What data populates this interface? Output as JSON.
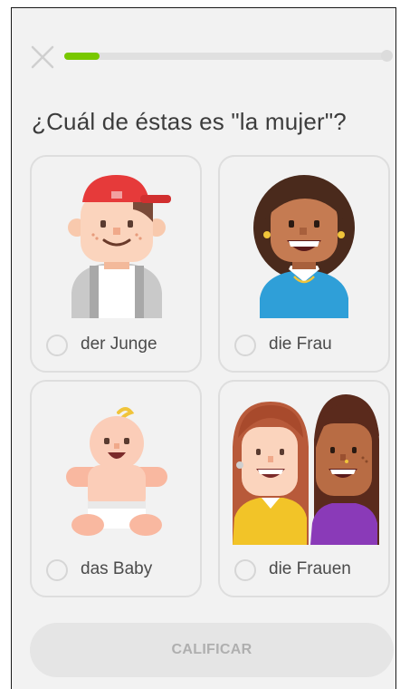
{
  "lesson": {
    "progress_fraction": 0.11,
    "accent_color": "#78c800"
  },
  "question": {
    "text": "¿Cuál de éstas es \"la mujer\"?"
  },
  "choices": [
    {
      "label": "der Junge",
      "image": "boy-red-cap-illustration"
    },
    {
      "label": "die Frau",
      "image": "woman-illustration"
    },
    {
      "label": "das Baby",
      "image": "baby-illustration"
    },
    {
      "label": "die Frauen",
      "image": "two-women-illustration"
    }
  ],
  "footer": {
    "check_label": "CALIFICAR"
  },
  "icons": {
    "close": "close-icon"
  }
}
